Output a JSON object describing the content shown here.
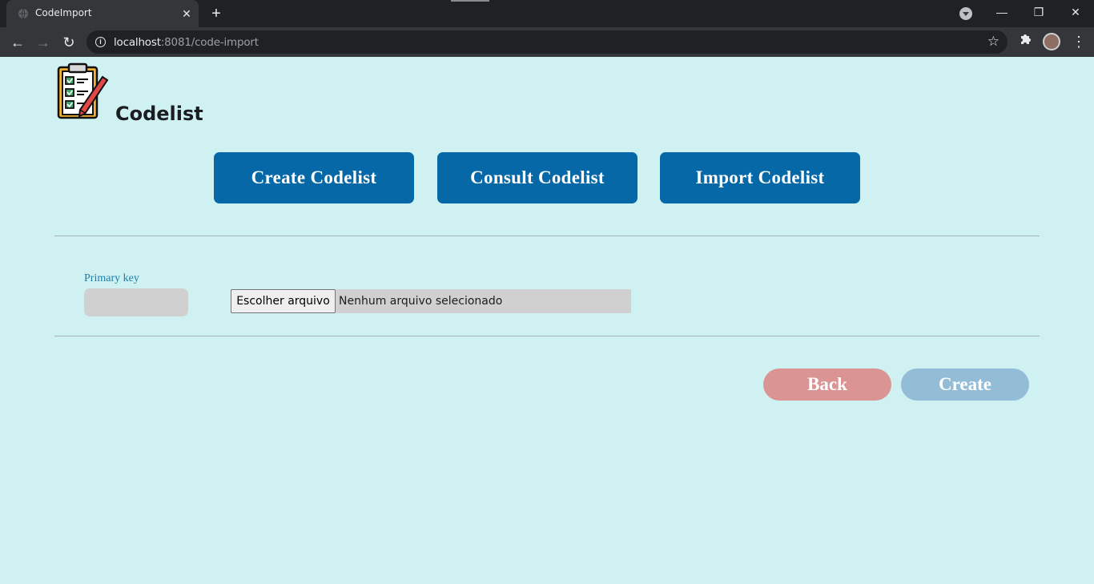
{
  "browser": {
    "tab_title": "CodeImport",
    "tab_close": "✕",
    "new_tab": "+",
    "url_host": "localhost",
    "url_rest": ":8081/code-import",
    "window_controls": {
      "minimize": "—",
      "restore": "❐",
      "close": "✕"
    }
  },
  "header": {
    "brand": "Codelist",
    "logo_icon": "clipboard-checklist-icon"
  },
  "nav": {
    "create": "Create Codelist",
    "consult": "Consult Codelist",
    "import": "Import Codelist"
  },
  "form": {
    "primary_key_label": "Primary key",
    "primary_key_value": "",
    "file_button": "Escolher arquivo",
    "file_status": "Nenhum arquivo selecionado"
  },
  "actions": {
    "back": "Back",
    "create": "Create"
  },
  "colors": {
    "page_bg": "#cff1f2",
    "nav_button": "#0668a6",
    "back_button": "#db9494",
    "create_button": "#93bdd7"
  }
}
